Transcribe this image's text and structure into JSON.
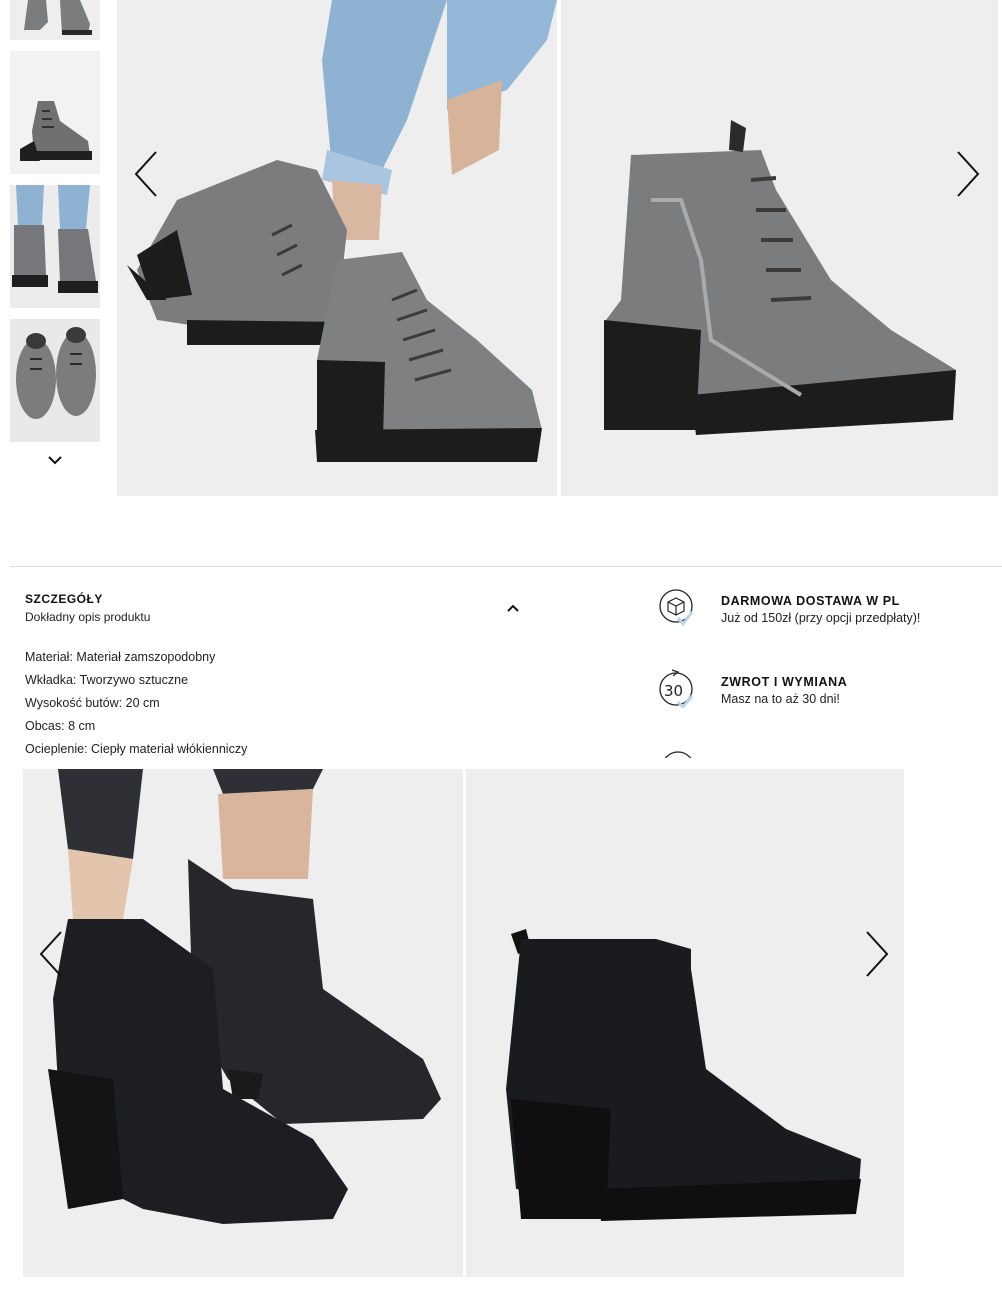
{
  "gallery_top": {
    "thumbnails": [
      "thumb-1",
      "thumb-2",
      "thumb-3",
      "thumb-4"
    ],
    "thumb_down_icon": "chevron-down-icon",
    "prev_icon": "chevron-left-icon",
    "next_icon": "chevron-right-icon",
    "colors": {
      "boot": "#7b7c7e",
      "sole": "#1c1c1c",
      "jeans": "#8fb2d3"
    }
  },
  "details": {
    "title": "SZCZEGÓŁY",
    "subtitle": "Dokładny opis produktu",
    "toggle_icon": "chevron-up-icon",
    "specs": [
      "Materiał: Materiał zamszopodobny",
      "Wkładka: Tworzywo sztuczne",
      "Wysokość butów: 20 cm",
      "Obcas: 8 cm",
      "Ocieplenie: Ciepły materiał włókienniczy"
    ]
  },
  "benefits": [
    {
      "icon": "delivery-box-icon",
      "title": "DARMOWA DOSTAWA W PL",
      "subtitle": "Już od 150zł (przy opcji przedpłaty)!"
    },
    {
      "icon": "return-30-icon",
      "icon_text": "30",
      "title": "ZWROT I WYMIANA",
      "subtitle": "Masz na to aż 30 dni!"
    }
  ],
  "gallery_bottom": {
    "prev_icon": "chevron-left-icon",
    "next_icon": "chevron-right-icon",
    "colors": {
      "boot": "#1d1e22",
      "jeans": "#2f3035"
    }
  },
  "accent": {
    "check": "#b9d5ea",
    "line": "#dcdcdc"
  }
}
